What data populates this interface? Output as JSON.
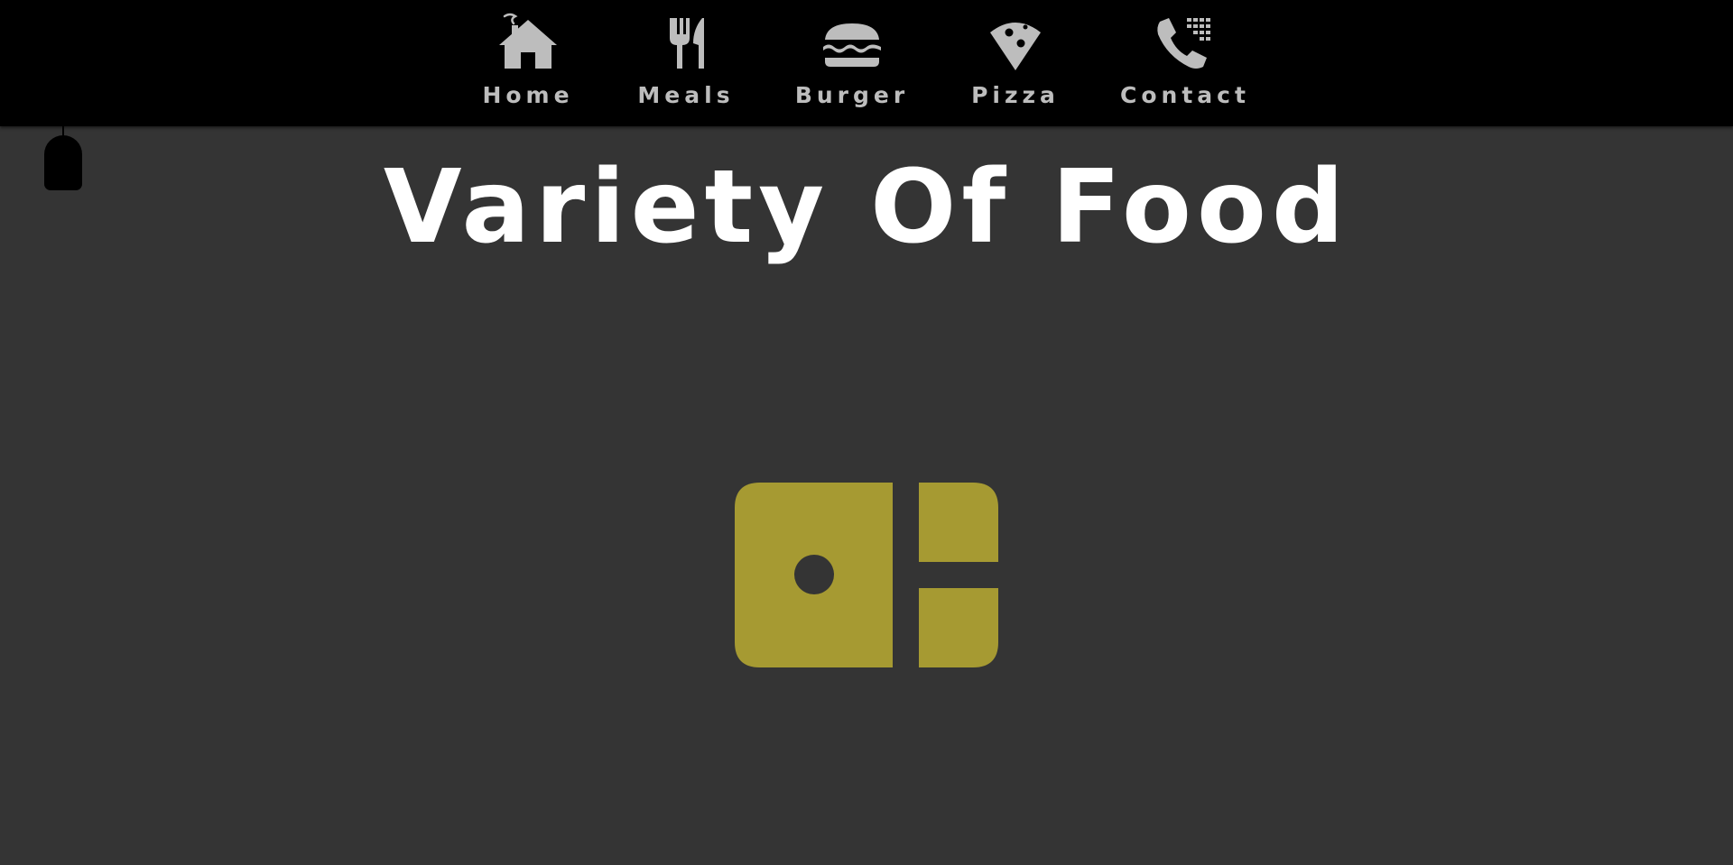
{
  "nav": {
    "items": [
      {
        "id": "home",
        "label": "Home",
        "icon": "house-icon"
      },
      {
        "id": "meals",
        "label": "Meals",
        "icon": "fork-knife-icon"
      },
      {
        "id": "burger",
        "label": "Burger",
        "icon": "burger-icon"
      },
      {
        "id": "pizza",
        "label": "Pizza",
        "icon": "pizza-slice-icon"
      },
      {
        "id": "contact",
        "label": "Contact",
        "icon": "phone-keypad-icon"
      }
    ]
  },
  "main": {
    "title": "Variety Of Food",
    "center_icon": "cash-register-icon"
  },
  "colors": {
    "background": "#343434",
    "navbar": "#000000",
    "nav_text": "#bdbdbd",
    "title_text": "#ffffff",
    "accent": "#a69a32"
  }
}
